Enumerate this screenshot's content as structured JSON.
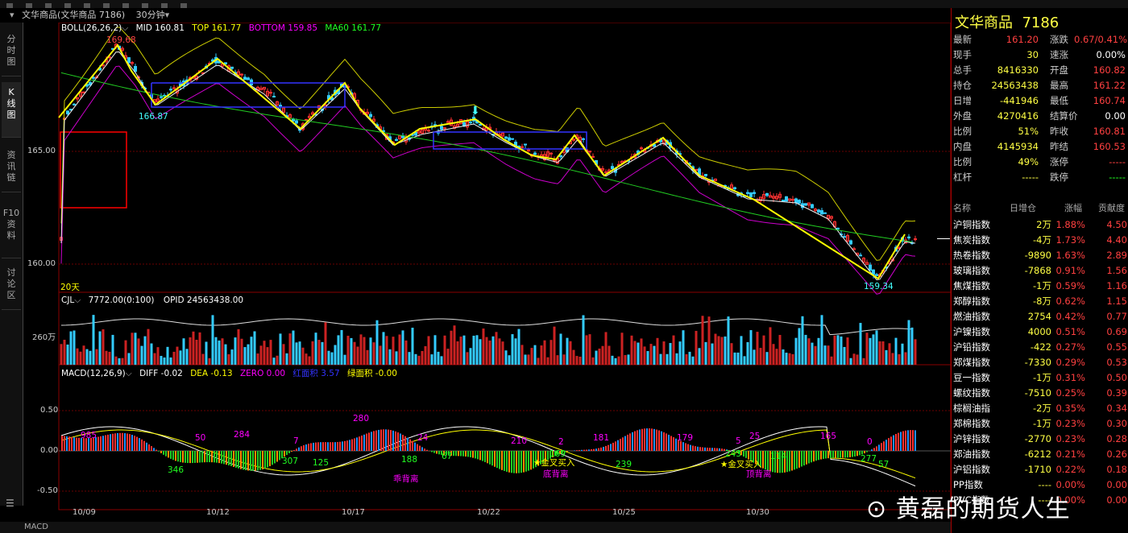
{
  "window": {
    "title": "文华商品(文华商品 7186)",
    "period": "30分钟"
  },
  "nav": [
    {
      "label": "分\n时\n图"
    },
    {
      "label": "K\n线\n图"
    },
    {
      "label": "资\n讯\n链"
    },
    {
      "label": "F10\n资\n料"
    },
    {
      "label": "讨\n论\n区"
    }
  ],
  "main_legend": {
    "boll": "BOLL(26,26,2)",
    "mid": "MID 160.81",
    "top": "TOP 161.77",
    "bottom": "BOTTOM 159.85",
    "ma60": "MA60 161.77"
  },
  "main_labels": {
    "high": "169.68",
    "low1": "166.87",
    "low2": "159.34",
    "days": "20天"
  },
  "y_main": [
    "165.00",
    "160.00"
  ],
  "vol_legend": {
    "cjl": "CJL",
    "val": "7772.00(0:100)",
    "opid": "OPID 24563438.00"
  },
  "y_vol": [
    "260万"
  ],
  "macd_legend": {
    "name": "MACD(12,26,9)",
    "diff": "DIFF -0.02",
    "dea": "DEA -0.13",
    "zero": "ZERO 0.00",
    "red_area": "红面积 3.57",
    "green_area": "绿面积 -0.00"
  },
  "y_macd": [
    "0.50",
    "0.00",
    "-0.50"
  ],
  "macd_labels": [
    "985",
    "50",
    "284",
    "7",
    "280",
    "24",
    "210",
    "2",
    "181",
    "179",
    "5",
    "25",
    "165",
    "0",
    "346",
    "307",
    "125",
    "188",
    "67",
    "169",
    "239",
    "243",
    "114",
    "277",
    "57"
  ],
  "macd_text": [
    "乖背离",
    "金叉买入",
    "底背离",
    "金叉买入",
    "顶背离"
  ],
  "x_dates": [
    "10/09",
    "10/12",
    "10/17",
    "10/22",
    "10/25",
    "10/30"
  ],
  "bottom_tab": "MACD",
  "quote": {
    "name": "文华商品",
    "code": "7186",
    "rows": [
      [
        "最新",
        "161.20",
        "涨跌",
        "0.67/0.41%"
      ],
      [
        "现手",
        "30",
        "速涨",
        "0.00%"
      ],
      [
        "总手",
        "8416330",
        "开盘",
        "160.82"
      ],
      [
        "持仓",
        "24563438",
        "最高",
        "161.22"
      ],
      [
        "日增",
        "-441946",
        "最低",
        "160.74"
      ],
      [
        "外盘",
        "4270416",
        "结算价",
        "0.00"
      ],
      [
        "比例",
        "51%",
        "昨收",
        "160.81"
      ],
      [
        "内盘",
        "4145934",
        "昨结",
        "160.53"
      ],
      [
        "比例",
        "49%",
        "涨停",
        "-----"
      ],
      [
        "杠杆",
        "-----",
        "跌停",
        "-----"
      ]
    ]
  },
  "index_header": [
    "名称",
    "日增仓",
    "涨幅",
    "贡献度"
  ],
  "index_rows": [
    [
      "沪铜指数",
      "2万",
      "1.88%",
      "4.50"
    ],
    [
      "焦炭指数",
      "-4万",
      "1.73%",
      "4.40"
    ],
    [
      "热卷指数",
      "-9890",
      "1.63%",
      "2.89"
    ],
    [
      "玻璃指数",
      "-7868",
      "0.91%",
      "1.56"
    ],
    [
      "焦煤指数",
      "-1万",
      "0.59%",
      "1.16"
    ],
    [
      "郑醇指数",
      "-8万",
      "0.62%",
      "1.15"
    ],
    [
      "燃油指数",
      "2754",
      "0.42%",
      "0.77"
    ],
    [
      "沪镍指数",
      "4000",
      "0.51%",
      "0.69"
    ],
    [
      "沪铅指数",
      "-422",
      "0.27%",
      "0.55"
    ],
    [
      "郑煤指数",
      "-7330",
      "0.29%",
      "0.53"
    ],
    [
      "豆一指数",
      "-1万",
      "0.31%",
      "0.50"
    ],
    [
      "螺纹指数",
      "-7510",
      "0.25%",
      "0.39"
    ],
    [
      "棕榈油指",
      "-2万",
      "0.35%",
      "0.34"
    ],
    [
      "郑棉指数",
      "-1万",
      "0.23%",
      "0.30"
    ],
    [
      "沪锌指数",
      "-2770",
      "0.23%",
      "0.28"
    ],
    [
      "郑油指数",
      "-6212",
      "0.21%",
      "0.26"
    ],
    [
      "沪铝指数",
      "-1710",
      "0.22%",
      "0.18"
    ],
    [
      "PP指数",
      "----",
      "0.00%",
      "0.00"
    ],
    [
      "PVC指数",
      "----",
      "0.00%",
      "0.00"
    ]
  ],
  "watermark": "黄磊的期货人生"
}
